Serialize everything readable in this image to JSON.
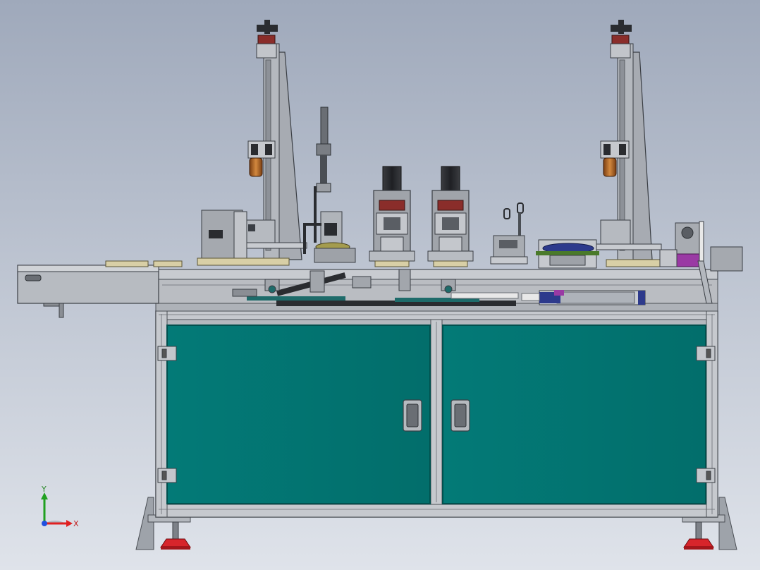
{
  "colors": {
    "bg_top": "#9fa9bb",
    "bg_bottom": "#dfe3ea",
    "frame": "#b4b8be",
    "frame_dark": "#5a5e64",
    "door": "#027673",
    "door_dark": "#01504e",
    "motor": "#2a2c30",
    "copper": "#b86a2e",
    "red_foot": "#d7252b",
    "purple": "#9a3aa4",
    "blue_plate": "#2d3a8c",
    "axis_x": "#e02020",
    "axis_y": "#20a020",
    "axis_z": "#2050e0"
  },
  "triad": {
    "x_label": "X",
    "y_label": "Y"
  }
}
